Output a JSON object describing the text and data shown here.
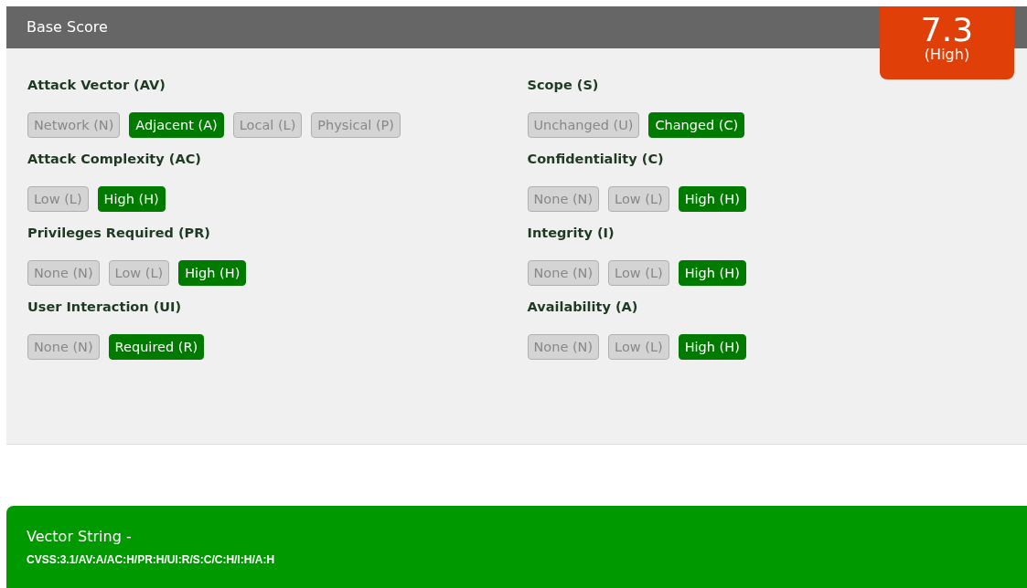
{
  "header": {
    "title": "Base Score"
  },
  "score": {
    "value": "7.3",
    "severity": "(High)"
  },
  "columns": [
    {
      "metrics": [
        {
          "label": "Attack Vector (AV)",
          "options": [
            {
              "label": "Network (N)",
              "selected": false
            },
            {
              "label": "Adjacent (A)",
              "selected": true
            },
            {
              "label": "Local (L)",
              "selected": false
            },
            {
              "label": "Physical (P)",
              "selected": false
            }
          ]
        },
        {
          "label": "Attack Complexity (AC)",
          "options": [
            {
              "label": "Low (L)",
              "selected": false
            },
            {
              "label": "High (H)",
              "selected": true
            }
          ]
        },
        {
          "label": "Privileges Required (PR)",
          "options": [
            {
              "label": "None (N)",
              "selected": false
            },
            {
              "label": "Low (L)",
              "selected": false
            },
            {
              "label": "High (H)",
              "selected": true
            }
          ]
        },
        {
          "label": "User Interaction (UI)",
          "options": [
            {
              "label": "None (N)",
              "selected": false
            },
            {
              "label": "Required (R)",
              "selected": true
            }
          ]
        }
      ]
    },
    {
      "metrics": [
        {
          "label": "Scope (S)",
          "options": [
            {
              "label": "Unchanged (U)",
              "selected": false
            },
            {
              "label": "Changed (C)",
              "selected": true
            }
          ]
        },
        {
          "label": "Confidentiality (C)",
          "options": [
            {
              "label": "None (N)",
              "selected": false
            },
            {
              "label": "Low (L)",
              "selected": false
            },
            {
              "label": "High (H)",
              "selected": true
            }
          ]
        },
        {
          "label": "Integrity (I)",
          "options": [
            {
              "label": "None (N)",
              "selected": false
            },
            {
              "label": "Low (L)",
              "selected": false
            },
            {
              "label": "High (H)",
              "selected": true
            }
          ]
        },
        {
          "label": "Availability (A)",
          "options": [
            {
              "label": "None (N)",
              "selected": false
            },
            {
              "label": "Low (L)",
              "selected": false
            },
            {
              "label": "High (H)",
              "selected": true
            }
          ]
        }
      ]
    }
  ],
  "vector": {
    "label": "Vector String -",
    "value": "CVSS:3.1/AV:A/AC:H/PR:H/UI:R/S:C/C:H/I:H/A:H"
  }
}
